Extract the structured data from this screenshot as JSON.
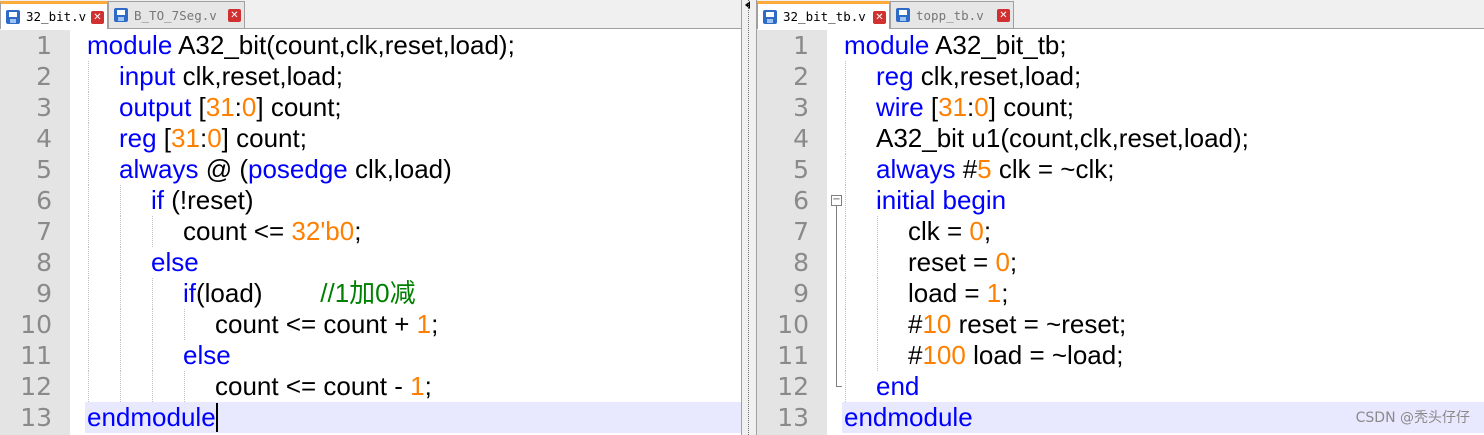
{
  "left": {
    "tabs": [
      {
        "label": "32_bit.v",
        "active": true
      },
      {
        "label": "B_TO_7Seg.v",
        "active": false
      }
    ],
    "lines": [
      {
        "n": "1",
        "indent": 0,
        "tokens": [
          {
            "t": "kw",
            "v": "module"
          },
          {
            "t": "plain",
            "v": " A32_bit(count,clk,reset,load);"
          }
        ]
      },
      {
        "n": "2",
        "indent": 1,
        "tokens": [
          {
            "t": "kw",
            "v": "input"
          },
          {
            "t": "plain",
            "v": " clk,reset,load;"
          }
        ]
      },
      {
        "n": "3",
        "indent": 1,
        "tokens": [
          {
            "t": "kw",
            "v": "output"
          },
          {
            "t": "plain",
            "v": " ["
          },
          {
            "t": "num",
            "v": "31"
          },
          {
            "t": "plain",
            "v": ":"
          },
          {
            "t": "num",
            "v": "0"
          },
          {
            "t": "plain",
            "v": "] count;"
          }
        ]
      },
      {
        "n": "4",
        "indent": 1,
        "tokens": [
          {
            "t": "kw",
            "v": "reg"
          },
          {
            "t": "plain",
            "v": " ["
          },
          {
            "t": "num",
            "v": "31"
          },
          {
            "t": "plain",
            "v": ":"
          },
          {
            "t": "num",
            "v": "0"
          },
          {
            "t": "plain",
            "v": "] count;"
          }
        ]
      },
      {
        "n": "5",
        "indent": 1,
        "tokens": [
          {
            "t": "kw",
            "v": "always"
          },
          {
            "t": "plain",
            "v": " @ ("
          },
          {
            "t": "kw",
            "v": "posedge"
          },
          {
            "t": "plain",
            "v": " clk,load)"
          }
        ]
      },
      {
        "n": "6",
        "indent": 2,
        "tokens": [
          {
            "t": "kw",
            "v": "if"
          },
          {
            "t": "plain",
            "v": " (!reset)"
          }
        ]
      },
      {
        "n": "7",
        "indent": 3,
        "tokens": [
          {
            "t": "plain",
            "v": "count <= "
          },
          {
            "t": "num",
            "v": "32'b0"
          },
          {
            "t": "plain",
            "v": ";"
          }
        ]
      },
      {
        "n": "8",
        "indent": 2,
        "tokens": [
          {
            "t": "kw",
            "v": "else"
          }
        ]
      },
      {
        "n": "9",
        "indent": 3,
        "tokens": [
          {
            "t": "kw",
            "v": "if"
          },
          {
            "t": "plain",
            "v": "(load)        "
          },
          {
            "t": "cm",
            "v": "//1加0减"
          }
        ]
      },
      {
        "n": "10",
        "indent": 4,
        "tokens": [
          {
            "t": "plain",
            "v": "count <= count + "
          },
          {
            "t": "num",
            "v": "1"
          },
          {
            "t": "plain",
            "v": ";"
          }
        ]
      },
      {
        "n": "11",
        "indent": 3,
        "tokens": [
          {
            "t": "kw",
            "v": "else"
          }
        ]
      },
      {
        "n": "12",
        "indent": 4,
        "tokens": [
          {
            "t": "plain",
            "v": "count <= count - "
          },
          {
            "t": "num",
            "v": "1"
          },
          {
            "t": "plain",
            "v": ";"
          }
        ]
      },
      {
        "n": "13",
        "indent": 0,
        "current": true,
        "caret": true,
        "tokens": [
          {
            "t": "kw",
            "v": "endmodule"
          }
        ]
      }
    ]
  },
  "right": {
    "tabs": [
      {
        "label": "32_bit_tb.v",
        "active": true
      },
      {
        "label": "topp_tb.v",
        "active": false
      }
    ],
    "lines": [
      {
        "n": "1",
        "indent": 0,
        "tokens": [
          {
            "t": "kw",
            "v": "module"
          },
          {
            "t": "plain",
            "v": " A32_bit_tb;"
          }
        ]
      },
      {
        "n": "2",
        "indent": 1,
        "tokens": [
          {
            "t": "kw",
            "v": "reg"
          },
          {
            "t": "plain",
            "v": " clk,reset,load;"
          }
        ]
      },
      {
        "n": "3",
        "indent": 1,
        "tokens": [
          {
            "t": "kw",
            "v": "wire"
          },
          {
            "t": "plain",
            "v": " ["
          },
          {
            "t": "num",
            "v": "31"
          },
          {
            "t": "plain",
            "v": ":"
          },
          {
            "t": "num",
            "v": "0"
          },
          {
            "t": "plain",
            "v": "] count;"
          }
        ]
      },
      {
        "n": "4",
        "indent": 1,
        "tokens": [
          {
            "t": "plain",
            "v": "A32_bit u1(count,clk,reset,load);"
          }
        ]
      },
      {
        "n": "5",
        "indent": 1,
        "tokens": [
          {
            "t": "kw",
            "v": "always"
          },
          {
            "t": "plain",
            "v": " #"
          },
          {
            "t": "num",
            "v": "5"
          },
          {
            "t": "plain",
            "v": " clk = ~clk;"
          }
        ]
      },
      {
        "n": "6",
        "indent": 1,
        "fold": "start",
        "tokens": [
          {
            "t": "kw",
            "v": "initial"
          },
          {
            "t": "plain",
            "v": " "
          },
          {
            "t": "kw",
            "v": "begin"
          }
        ]
      },
      {
        "n": "7",
        "indent": 2,
        "fold": "mid",
        "tokens": [
          {
            "t": "plain",
            "v": "clk = "
          },
          {
            "t": "num",
            "v": "0"
          },
          {
            "t": "plain",
            "v": ";"
          }
        ]
      },
      {
        "n": "8",
        "indent": 2,
        "fold": "mid",
        "tokens": [
          {
            "t": "plain",
            "v": "reset = "
          },
          {
            "t": "num",
            "v": "0"
          },
          {
            "t": "plain",
            "v": ";"
          }
        ]
      },
      {
        "n": "9",
        "indent": 2,
        "fold": "mid",
        "tokens": [
          {
            "t": "plain",
            "v": "load = "
          },
          {
            "t": "num",
            "v": "1"
          },
          {
            "t": "plain",
            "v": ";"
          }
        ]
      },
      {
        "n": "10",
        "indent": 2,
        "fold": "mid",
        "tokens": [
          {
            "t": "plain",
            "v": "#"
          },
          {
            "t": "num",
            "v": "10"
          },
          {
            "t": "plain",
            "v": " reset = ~reset;"
          }
        ]
      },
      {
        "n": "11",
        "indent": 2,
        "fold": "mid",
        "tokens": [
          {
            "t": "plain",
            "v": "#"
          },
          {
            "t": "num",
            "v": "100"
          },
          {
            "t": "plain",
            "v": " load = ~load;"
          }
        ]
      },
      {
        "n": "12",
        "indent": 1,
        "fold": "end",
        "tokens": [
          {
            "t": "kw",
            "v": "end"
          }
        ]
      },
      {
        "n": "13",
        "indent": 0,
        "current": true,
        "tokens": [
          {
            "t": "kw",
            "v": "endmodule"
          }
        ]
      }
    ]
  },
  "watermark": "CSDN @秃头仔仔"
}
